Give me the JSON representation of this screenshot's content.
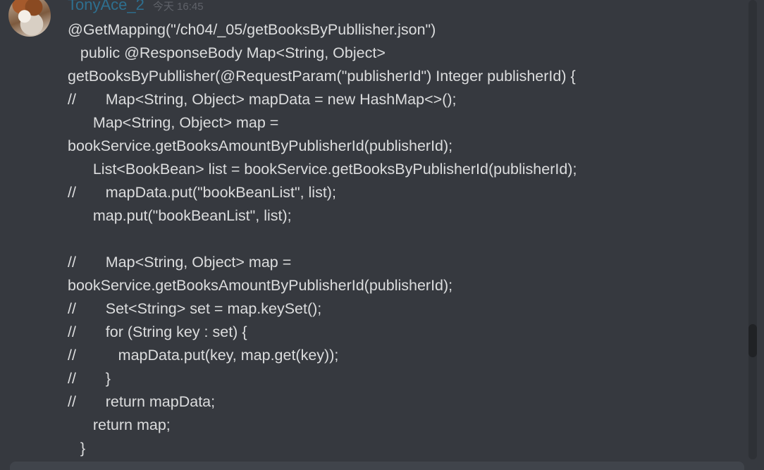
{
  "message": {
    "author": "TonyAce_2",
    "timestamp": "今天 16:45",
    "code_lines": [
      "@GetMapping(\"/ch04/_05/getBooksByPubllisher.json\")",
      "   public @ResponseBody Map<String, Object>",
      "getBooksByPubllisher(@RequestParam(\"publisherId\") Integer publisherId) {",
      "//       Map<String, Object> mapData = new HashMap<>();",
      "      Map<String, Object> map =",
      "bookService.getBooksAmountByPublisherId(publisherId);",
      "      List<BookBean> list = bookService.getBooksByPublisherId(publisherId);",
      "//       mapData.put(\"bookBeanList\", list);",
      "      map.put(\"bookBeanList\", list);",
      "",
      "//       Map<String, Object> map =",
      "bookService.getBooksAmountByPublisherId(publisherId);",
      "//       Set<String> set = map.keySet();",
      "//       for (String key : set) {",
      "//          mapData.put(key, map.get(key));",
      "//       }",
      "//       return mapData;",
      "      return map;",
      "   }"
    ]
  },
  "colors": {
    "background": "#36393f",
    "username": "#2e6f8f",
    "timestamp": "#5f6269",
    "text": "#dcddde"
  }
}
